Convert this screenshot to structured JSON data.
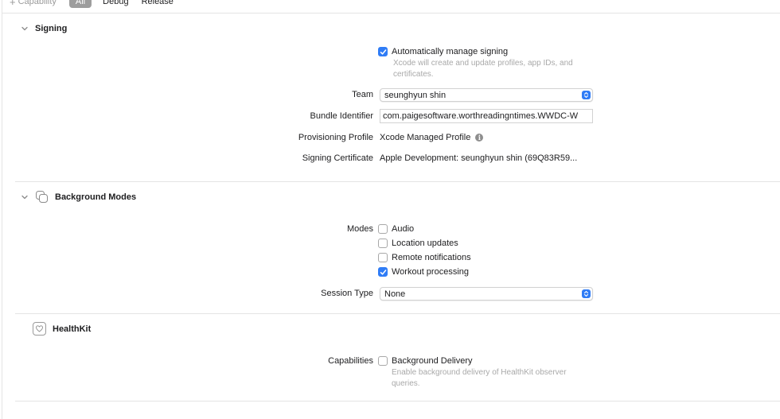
{
  "toolbar": {
    "add_capability_label": "Capability",
    "filters": [
      "All",
      "Debug",
      "Release"
    ],
    "active_filter": "All"
  },
  "signing": {
    "title": "Signing",
    "auto_manage_label": "Automatically manage signing",
    "auto_manage_checked": true,
    "auto_manage_help": "Xcode will create and update profiles, app IDs, and certificates.",
    "team_label": "Team",
    "team_value": "seunghyun shin",
    "bundle_id_label": "Bundle Identifier",
    "bundle_id_value": "com.paigesoftware.worthreadingntimes.WWDC-W",
    "profile_label": "Provisioning Profile",
    "profile_value": "Xcode Managed Profile",
    "certificate_label": "Signing Certificate",
    "certificate_value": "Apple Development: seunghyun shin (69Q83R59..."
  },
  "background_modes": {
    "title": "Background Modes",
    "modes_label": "Modes",
    "modes": [
      {
        "label": "Audio",
        "checked": false
      },
      {
        "label": "Location updates",
        "checked": false
      },
      {
        "label": "Remote notifications",
        "checked": false
      },
      {
        "label": "Workout processing",
        "checked": true
      }
    ],
    "session_type_label": "Session Type",
    "session_type_value": "None"
  },
  "healthkit": {
    "title": "HealthKit",
    "capabilities_label": "Capabilities",
    "background_delivery_label": "Background Delivery",
    "background_delivery_checked": false,
    "background_delivery_help": "Enable background delivery of HealthKit observer queries."
  },
  "colors": {
    "accent": "#2f7cf6",
    "secondary_text": "#a9a9a9",
    "divider": "#e4e4e4"
  }
}
